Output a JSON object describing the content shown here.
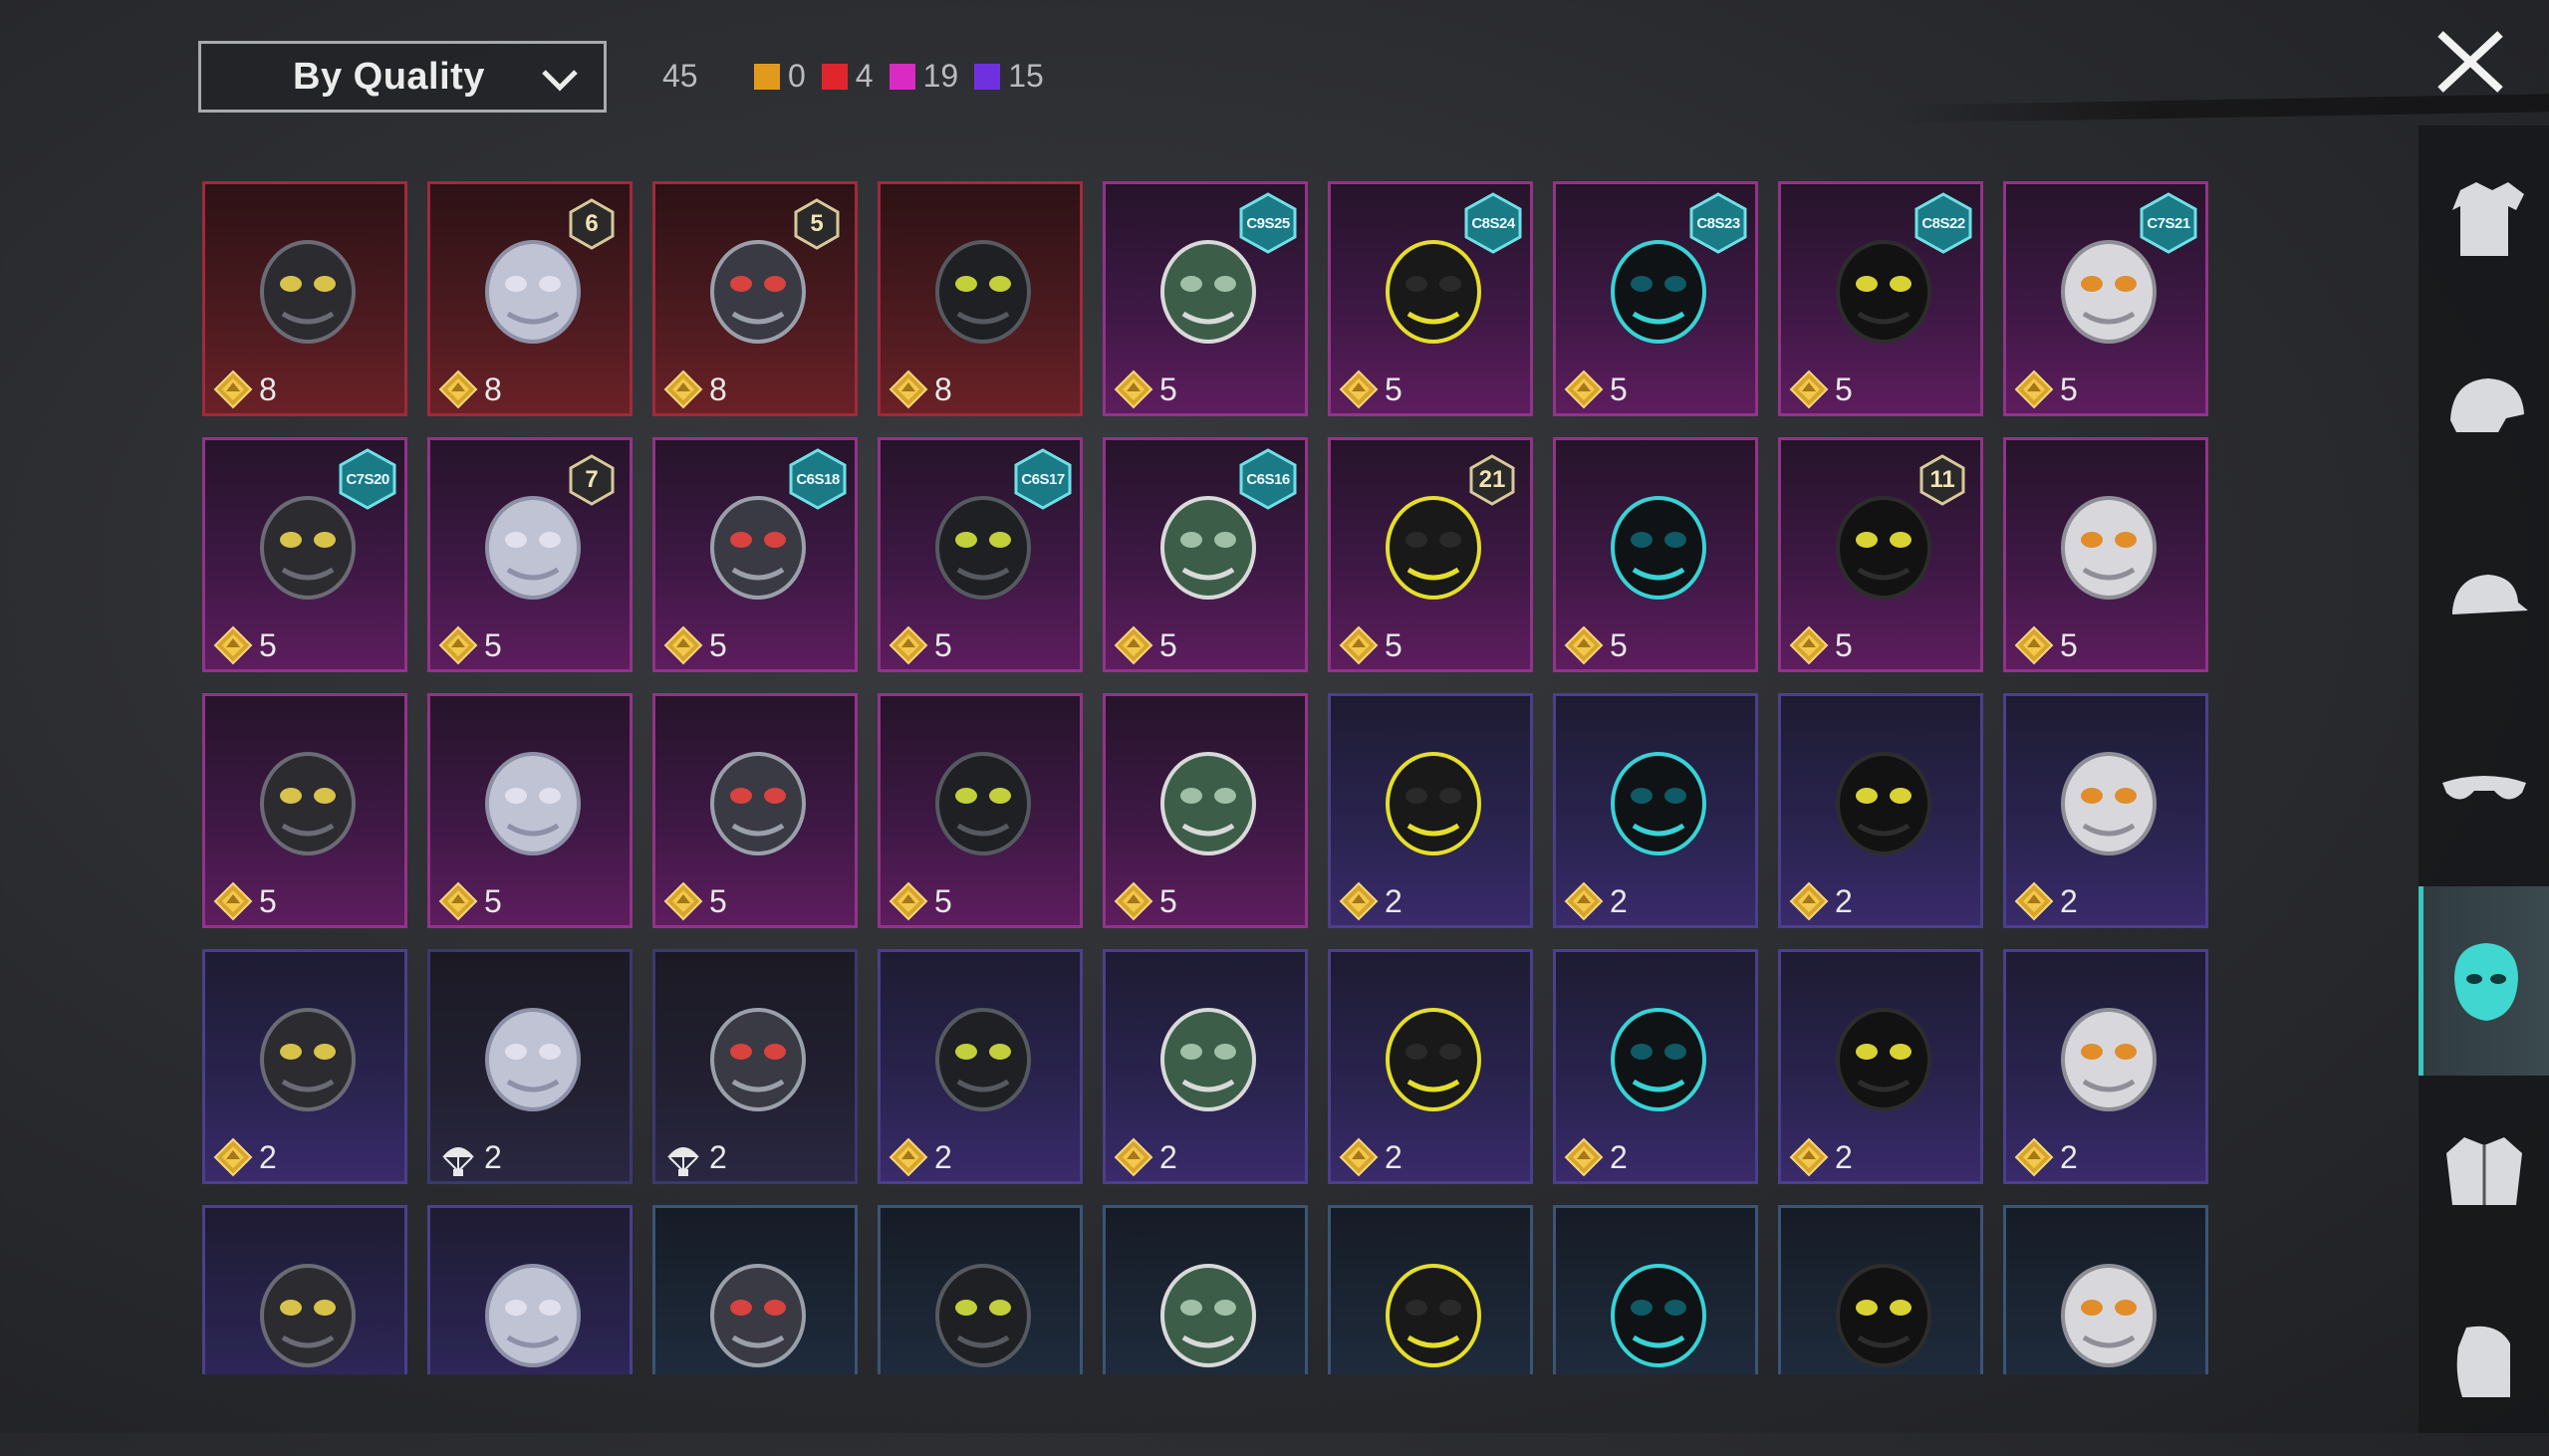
{
  "sort": {
    "label": "By Quality"
  },
  "total": "45",
  "quality_counts": [
    {
      "color": "#e29a1c",
      "count": "0"
    },
    {
      "color": "#e0262d",
      "count": "4"
    },
    {
      "color": "#d92bc3",
      "count": "19"
    },
    {
      "color": "#6f31e0",
      "count": "15"
    }
  ],
  "currency_icon": "gold-coin-icon",
  "items": [
    {
      "quality": "red",
      "art": "skull-visor-mask",
      "price": "8"
    },
    {
      "quality": "red",
      "art": "plague-doctor-mask",
      "price": "8",
      "level": "6"
    },
    {
      "quality": "red",
      "art": "cyber-respirator-mask",
      "price": "8",
      "level": "5"
    },
    {
      "quality": "red",
      "art": "dark-helmet-mask",
      "price": "8"
    },
    {
      "quality": "pink",
      "art": "green-folded-mask",
      "price": "5",
      "season": "C9S25"
    },
    {
      "quality": "pink",
      "art": "yellow-visor",
      "price": "5",
      "season": "C8S24"
    },
    {
      "quality": "pink",
      "art": "teal-neon-mask",
      "price": "5",
      "season": "C8S23"
    },
    {
      "quality": "pink",
      "art": "black-ring-mask",
      "price": "5",
      "season": "C8S22"
    },
    {
      "quality": "pink",
      "art": "white-armor-mask",
      "price": "5",
      "season": "C7S21"
    },
    {
      "quality": "pink",
      "art": "black-face-mask",
      "price": "5",
      "season": "C7S20"
    },
    {
      "quality": "pink",
      "art": "wire-earpiece",
      "price": "5",
      "level": "7"
    },
    {
      "quality": "pink",
      "art": "gold-horn-mask",
      "price": "5",
      "season": "C6S18"
    },
    {
      "quality": "pink",
      "art": "graffiti-cloth-mask",
      "price": "5",
      "season": "C6S17"
    },
    {
      "quality": "pink",
      "art": "yellow-gas-mask",
      "price": "5",
      "season": "C6S16"
    },
    {
      "quality": "pink",
      "art": "joker-mask",
      "price": "5",
      "level": "21"
    },
    {
      "quality": "pink",
      "art": "gold-wing-mask",
      "price": "5"
    },
    {
      "quality": "pink",
      "art": "red-oni-mask",
      "price": "5",
      "level": "11"
    },
    {
      "quality": "pink",
      "art": "clown-mask",
      "price": "5"
    },
    {
      "quality": "pink",
      "art": "skull-bandana",
      "price": "5"
    },
    {
      "quality": "pink",
      "art": "neon-skull-mask",
      "price": "5"
    },
    {
      "quality": "pink",
      "art": "leather-beak-mask",
      "price": "5"
    },
    {
      "quality": "pink",
      "art": "red-nose",
      "price": "5"
    },
    {
      "quality": "pink",
      "art": "black-scarf-mask",
      "price": "5"
    },
    {
      "quality": "purple",
      "art": "gray-half-mask",
      "price": "2"
    },
    {
      "quality": "purple",
      "art": "red-lens-device",
      "price": "2"
    },
    {
      "quality": "purple",
      "art": "mammoth-mask",
      "price": "2"
    },
    {
      "quality": "purple",
      "art": "pink-dino-mask",
      "price": "2"
    },
    {
      "quality": "purple",
      "art": "purple-goggle-mask",
      "price": "2"
    },
    {
      "quality": "dark",
      "art": "blue-spike-mask",
      "price": "2",
      "currency": "parachute-coin-icon"
    },
    {
      "quality": "dark",
      "art": "black-half-mask",
      "price": "2",
      "currency": "parachute-coin-icon"
    },
    {
      "quality": "purple",
      "art": "dark-hood-mask",
      "price": "2"
    },
    {
      "quality": "purple",
      "art": "white-visor-helmet",
      "price": "2"
    },
    {
      "quality": "purple",
      "art": "bandage-wrap",
      "price": "2"
    },
    {
      "quality": "purple",
      "art": "black-gas-mask",
      "price": "2"
    },
    {
      "quality": "purple",
      "art": "white-face-mask",
      "price": "2"
    },
    {
      "quality": "purple",
      "art": "dark-skull-mask",
      "price": "2"
    },
    {
      "quality": "purple",
      "art": "black-armor-mask"
    },
    {
      "quality": "purple",
      "art": "usa-flag-bandana"
    },
    {
      "quality": "blue",
      "art": "bronze-skull-mask"
    },
    {
      "quality": "blue",
      "art": "yellow-net-bandana"
    },
    {
      "quality": "blue",
      "art": "green-web-bandana"
    },
    {
      "quality": "blue",
      "art": "purple-theatre-mask"
    },
    {
      "quality": "blue",
      "art": "gold-pink-mask"
    },
    {
      "quality": "blue",
      "art": "camo-cloth-mask"
    },
    {
      "quality": "blue",
      "art": "wire-hood-mask"
    }
  ],
  "sidebar": [
    {
      "name": "outfit-category",
      "icon": "outfit-icon"
    },
    {
      "name": "helmet-category",
      "icon": "helmet-icon"
    },
    {
      "name": "cap-category",
      "icon": "cap-icon"
    },
    {
      "name": "glasses-category",
      "icon": "glasses-icon"
    },
    {
      "name": "mask-category",
      "icon": "mask-icon",
      "active": true
    },
    {
      "name": "jacket-category",
      "icon": "jacket-icon"
    },
    {
      "name": "face-category",
      "icon": "face-icon"
    }
  ]
}
